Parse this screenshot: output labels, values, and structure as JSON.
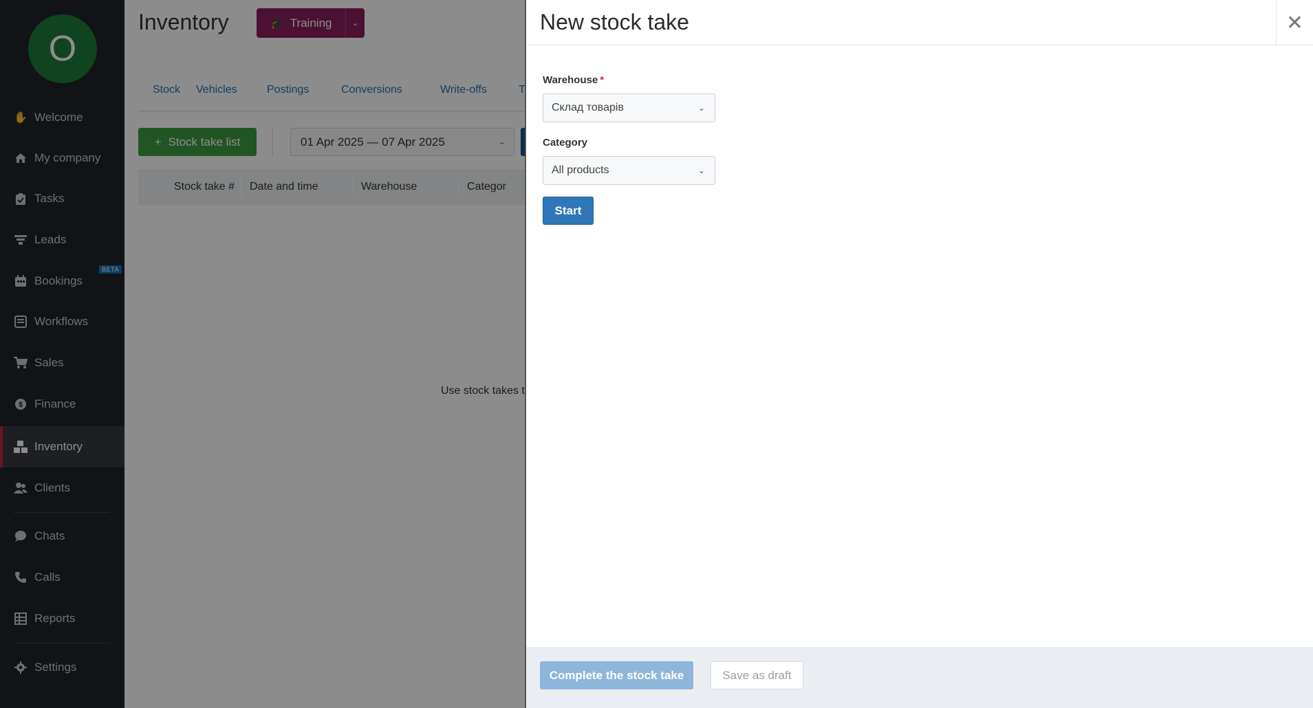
{
  "sidebar": {
    "avatar_initial": "O",
    "beta_badge": "BETA",
    "items": [
      {
        "label": "Welcome",
        "icon": "waving-hand-icon"
      },
      {
        "label": "My company",
        "icon": "home-icon"
      },
      {
        "label": "Tasks",
        "icon": "clipboard-icon"
      },
      {
        "label": "Leads",
        "icon": "funnel-icon"
      },
      {
        "label": "Bookings",
        "icon": "calendar-icon"
      },
      {
        "label": "Workflows",
        "icon": "inbox-icon"
      },
      {
        "label": "Sales",
        "icon": "cart-icon"
      },
      {
        "label": "Finance",
        "icon": "dollar-circle-icon"
      },
      {
        "label": "Inventory",
        "icon": "boxes-icon",
        "active": true
      },
      {
        "label": "Clients",
        "icon": "users-icon"
      },
      {
        "label": "Chats",
        "icon": "chat-bubble-icon"
      },
      {
        "label": "Calls",
        "icon": "phone-icon"
      },
      {
        "label": "Reports",
        "icon": "table-icon"
      },
      {
        "label": "Settings",
        "icon": "gear-icon"
      }
    ]
  },
  "page": {
    "title": "Inventory",
    "training_label": "Training",
    "tabs": [
      "Stock",
      "Vehicles",
      "Postings",
      "Conversions",
      "Write-offs",
      "T"
    ],
    "stock_take_list_label": "Stock take list",
    "date_range": "01 Apr 2025 — 07 Apr 2025",
    "table_headers": [
      "Stock take #",
      "Date and time",
      "Warehouse",
      "Categor"
    ],
    "empty_text": "Use stock takes to"
  },
  "drawer": {
    "title": "New stock take",
    "warehouse_label": "Warehouse",
    "warehouse_value": "Склад товарів",
    "category_label": "Category",
    "category_value": "All products",
    "start_label": "Start",
    "complete_label": "Complete the stock take",
    "draft_label": "Save as draft"
  },
  "colors": {
    "sidebar_bg": "#1f2428",
    "avatar_bg": "#1e7a39",
    "active_marker": "#c4283a",
    "training_bg": "#8b1f5b",
    "green_button": "#3c9c42",
    "primary_blue": "#2f77b9",
    "disabled_blue": "#8eb6db"
  }
}
